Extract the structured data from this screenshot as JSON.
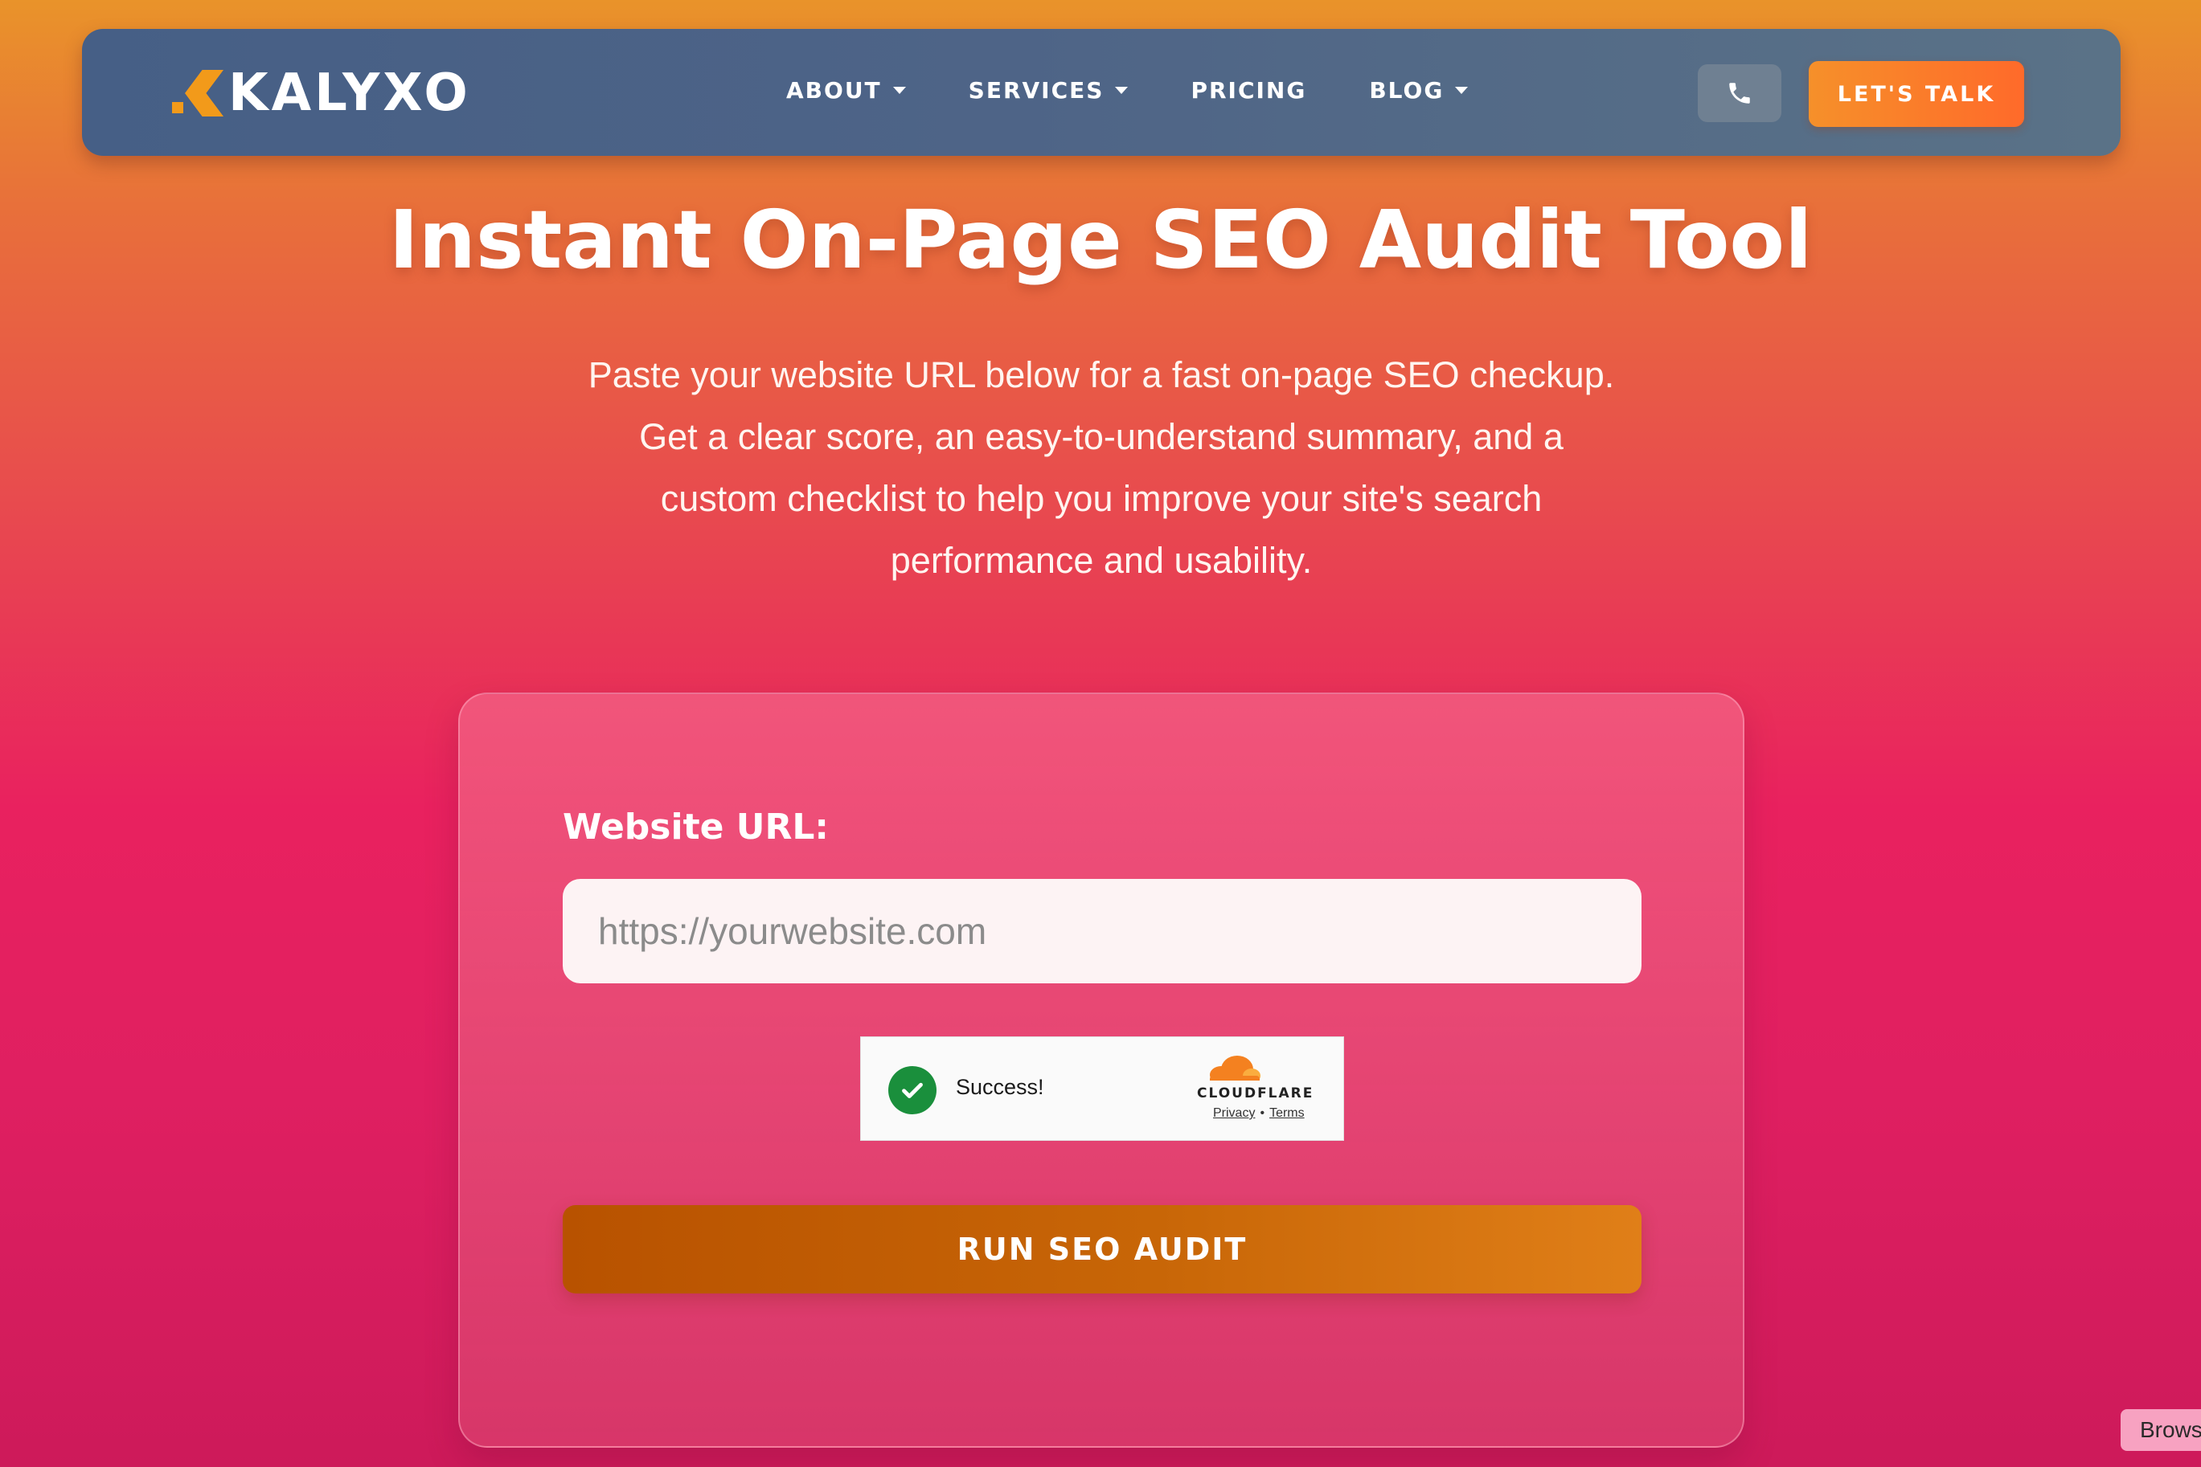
{
  "nav": {
    "logo_text": "KALYXO",
    "items": [
      {
        "label": "ABOUT",
        "has_dropdown": true
      },
      {
        "label": "SERVICES",
        "has_dropdown": true
      },
      {
        "label": "PRICING",
        "has_dropdown": false
      },
      {
        "label": "BLOG",
        "has_dropdown": true
      }
    ],
    "phone_icon": "phone-icon",
    "cta_label": "LET'S TALK"
  },
  "hero": {
    "title": "Instant On-Page SEO Audit Tool",
    "lines": [
      "Paste your website URL below for a fast on-page SEO checkup.",
      "Get a clear score, an easy-to-understand summary, and a",
      "custom checklist to help you improve your site's search",
      "performance and usability."
    ]
  },
  "form": {
    "url_label": "Website URL:",
    "url_value": "",
    "url_placeholder": "https://yourwebsite.com",
    "captcha": {
      "status_text": "Success!",
      "brand": "CLOUDFLARE",
      "privacy_label": "Privacy",
      "separator": "•",
      "terms_label": "Terms"
    },
    "submit_label": "RUN SEO AUDIT"
  },
  "browse_tab_label": "Brows",
  "colors": {
    "accent_orange": "#f6902a",
    "nav_bg": "#4e6487",
    "success_green": "#1a8f3c",
    "button_orange": "#c86607"
  }
}
